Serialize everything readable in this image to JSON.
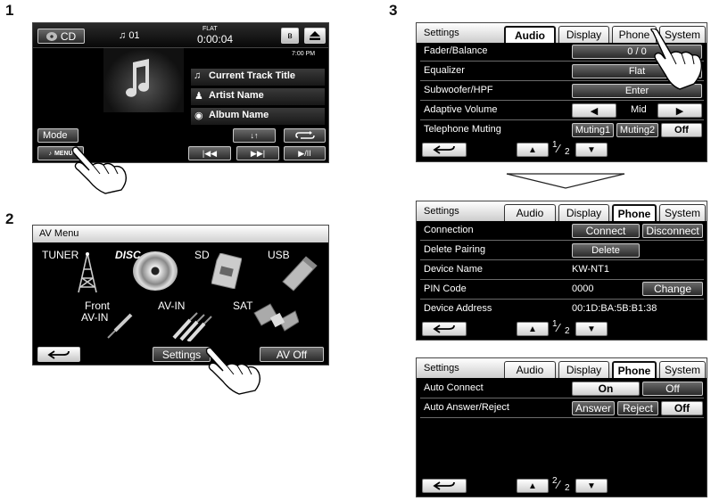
{
  "steps": [
    "1",
    "2",
    "3"
  ],
  "s1": {
    "source": "CD",
    "track_no": "01",
    "eq": "FLAT",
    "time": "0:00:04",
    "clock": "7:00 PM",
    "track_title": "Current Track Title",
    "artist": "Artist Name",
    "album": "Album Name",
    "mode": "Mode",
    "menu": "MENU"
  },
  "s2": {
    "title": "AV Menu",
    "tuner": "TUNER",
    "disc": "DISC",
    "sd": "SD",
    "usb": "USB",
    "front": "Front",
    "avin_sub": "AV-IN",
    "avin": "AV-IN",
    "sat": "SAT",
    "settings": "Settings",
    "avoff": "AV Off"
  },
  "tabs": {
    "settings": "Settings",
    "audio": "Audio",
    "display": "Display",
    "phone": "Phone",
    "system": "System"
  },
  "s3a": {
    "rows": [
      "Fader/Balance",
      "Equalizer",
      "Subwoofer/HPF",
      "Adaptive Volume",
      "Telephone Muting"
    ],
    "fader": "0 / 0",
    "eq": "Flat",
    "sub": "Enter",
    "adaptive": "Mid",
    "mut1": "Muting1",
    "mut2": "Muting2",
    "mut_off": "Off",
    "page": "1",
    "pages": "2"
  },
  "s3b": {
    "rows": [
      "Connection",
      "Delete Pairing",
      "Device Name",
      "PIN Code",
      "Device Address"
    ],
    "connect": "Connect",
    "disconnect": "Disconnect",
    "delete": "Delete",
    "device_name": "KW-NT1",
    "pin": "0000",
    "change": "Change",
    "address": "00:1D:BA:5B:B1:38",
    "page": "1",
    "pages": "2"
  },
  "s3c": {
    "rows": [
      "Auto Connect",
      "Auto Answer/Reject"
    ],
    "on": "On",
    "off": "Off",
    "answer": "Answer",
    "reject": "Reject",
    "off2": "Off",
    "page": "2",
    "pages": "2"
  }
}
